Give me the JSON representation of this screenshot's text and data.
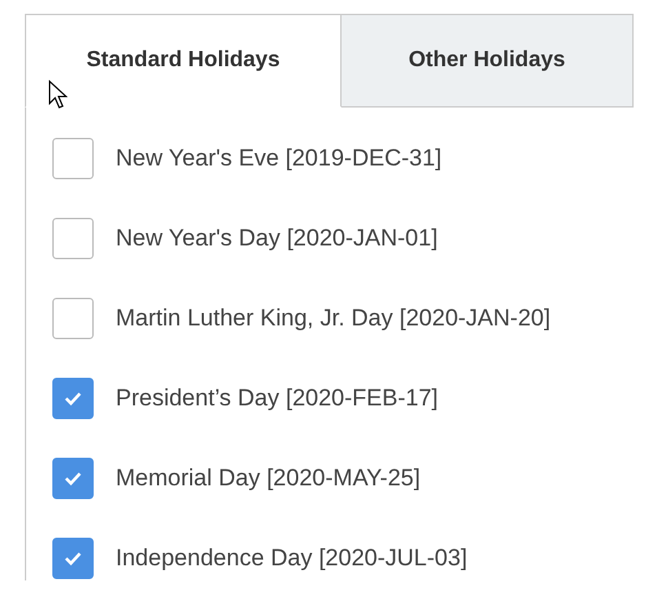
{
  "tabs": [
    {
      "label": "Standard Holidays",
      "selected": true
    },
    {
      "label": "Other Holidays",
      "selected": false
    }
  ],
  "holidays": [
    {
      "label": "New Year's Eve [2019-DEC-31]",
      "checked": false
    },
    {
      "label": "New Year's Day [2020-JAN-01]",
      "checked": false
    },
    {
      "label": "Martin Luther King, Jr. Day [2020-JAN-20]",
      "checked": false
    },
    {
      "label": "President’s Day [2020-FEB-17]",
      "checked": true
    },
    {
      "label": "Memorial Day [2020-MAY-25]",
      "checked": true
    },
    {
      "label": "Independence Day [2020-JUL-03]",
      "checked": true
    }
  ]
}
